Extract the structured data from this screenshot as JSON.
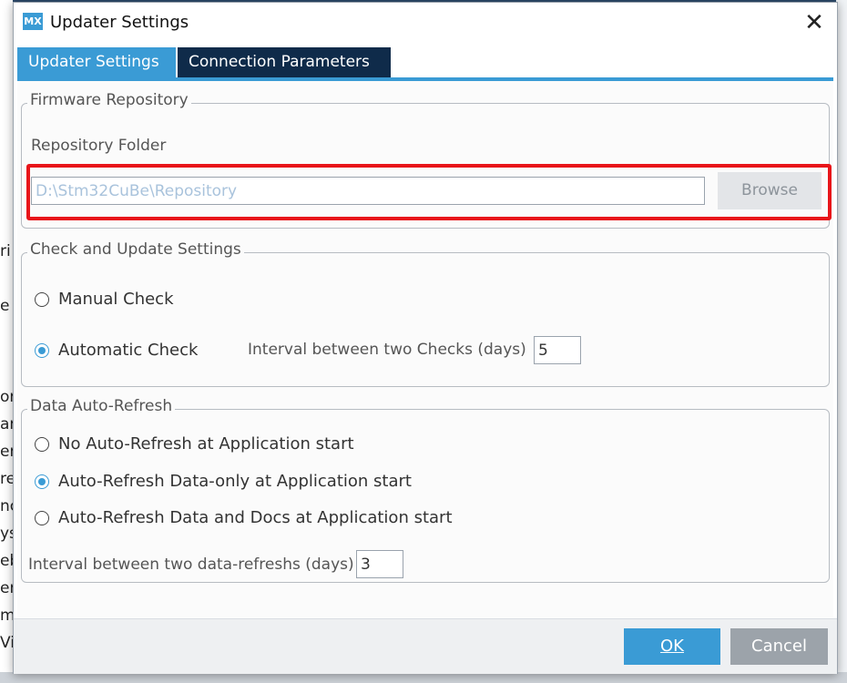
{
  "dialog": {
    "title": "Updater Settings",
    "icon_name": "mx-app-icon",
    "icon_text": "MX",
    "close_symbol": "✕"
  },
  "tabs": [
    {
      "label": "Updater Settings",
      "active": true
    },
    {
      "label": "Connection Parameters",
      "active": false
    }
  ],
  "firmware_repository": {
    "legend": "Firmware Repository",
    "folder_label": "Repository Folder",
    "folder_value": "D:\\Stm32CuBe\\Repository",
    "browse_label": "Browse"
  },
  "check_update": {
    "legend": "Check and Update Settings",
    "manual_label": "Manual Check",
    "automatic_label": "Automatic Check",
    "selected": "automatic",
    "interval_label": "Interval between two Checks (days)",
    "interval_value": "5"
  },
  "auto_refresh": {
    "legend": "Data Auto-Refresh",
    "options": [
      {
        "label": "No Auto-Refresh at Application start",
        "checked": false
      },
      {
        "label": "Auto-Refresh Data-only at Application start",
        "checked": true
      },
      {
        "label": "Auto-Refresh Data and Docs at Application start",
        "checked": false
      }
    ],
    "interval_label": "Interval between two data-refreshs (days)",
    "interval_value": "3"
  },
  "footer": {
    "ok_label": "OK",
    "cancel_label": "Cancel"
  },
  "background_fragments": {
    "left_texts": [
      "ri",
      "e",
      "or",
      "ar",
      "er",
      "re",
      "nc",
      "ys",
      "eb",
      "er",
      "m",
      "Vi"
    ]
  },
  "colors": {
    "accent": "#3a9bd5",
    "tab_inactive": "#0f2b4a",
    "highlight": "#e8151a"
  }
}
